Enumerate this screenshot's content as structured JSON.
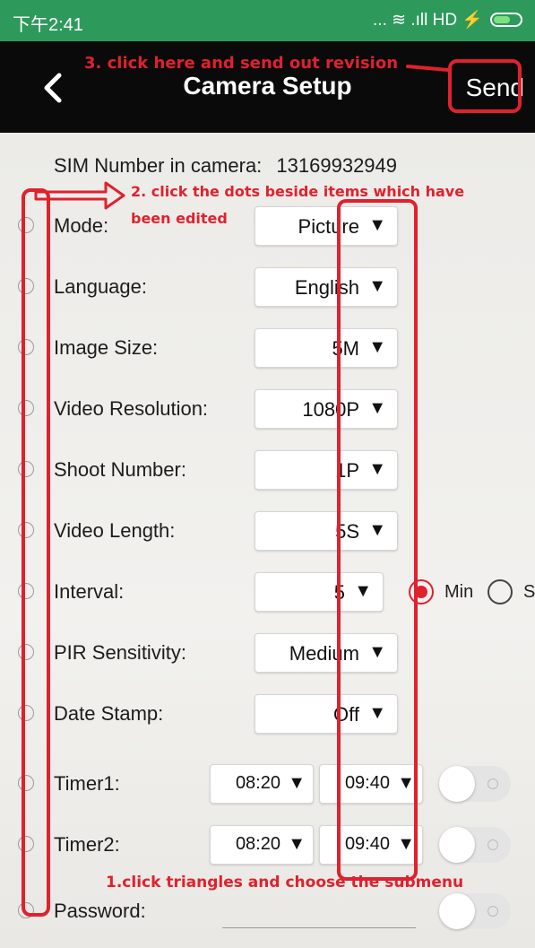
{
  "status_bar": {
    "time": "下午2:41",
    "icons_text": "... ≋ .ıll HD ⚡"
  },
  "app_bar": {
    "title": "Camera Setup",
    "send_label": "Send"
  },
  "sim": {
    "label": "SIM Number in camera:",
    "value": "13169932949"
  },
  "settings": [
    {
      "label": "Mode:",
      "value": "Picture"
    },
    {
      "label": "Language:",
      "value": "English"
    },
    {
      "label": "Image Size:",
      "value": "5M"
    },
    {
      "label": "Video Resolution:",
      "value": "1080P"
    },
    {
      "label": "Shoot Number:",
      "value": "1P"
    },
    {
      "label": "Video Length:",
      "value": "5S"
    },
    {
      "label": "Interval:",
      "value": "5",
      "units": [
        {
          "label": "Min",
          "selected": true
        },
        {
          "label": "S",
          "selected": false
        }
      ]
    },
    {
      "label": "PIR Sensitivity:",
      "value": "Medium"
    },
    {
      "label": "Date Stamp:",
      "value": "Off"
    },
    {
      "label": "Timer1:",
      "start": "08:20",
      "end": "09:40",
      "enabled": false
    },
    {
      "label": "Timer2:",
      "start": "08:20",
      "end": "09:40",
      "enabled": false
    },
    {
      "label": "Password:",
      "value": "",
      "enabled": false
    }
  ],
  "annotations": {
    "step1": "1.click triangles and choose the submenu",
    "step2_line1": "2. click the dots beside items which have",
    "step2_line2": "been edited",
    "step3": "3. click here and send out revision"
  },
  "colors": {
    "status_bar": "#2d9a5c",
    "app_bar": "#0a0a0a",
    "annotation": "#e0212e",
    "radio_selected": "#e0212e"
  }
}
